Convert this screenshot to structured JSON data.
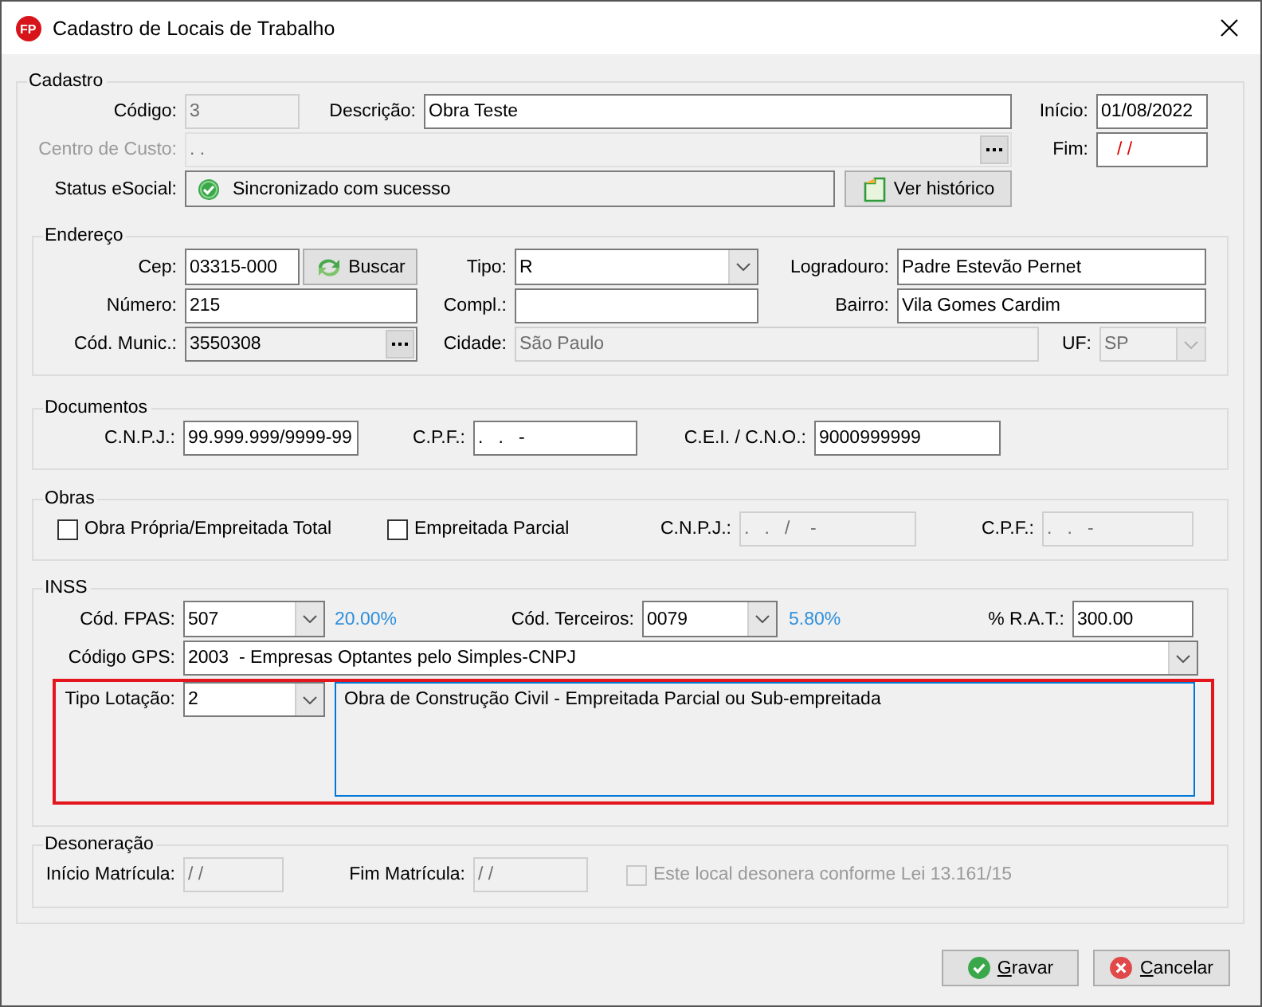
{
  "window": {
    "title": "Cadastro de Locais de Trabalho",
    "logo_text": "FP"
  },
  "cadastro": {
    "legend": "Cadastro",
    "codigo": {
      "label": "Código:",
      "value": "3",
      "read_only": true
    },
    "descricao": {
      "label": "Descrição:",
      "value": "Obra Teste"
    },
    "inicio": {
      "label": "Início:",
      "value": "01/08/2022"
    },
    "centro_de_custo": {
      "label": "Centro de Custo:",
      "value": ". .",
      "disabled": true
    },
    "fim": {
      "label": "Fim:",
      "value": "/ /",
      "error": true
    },
    "status_esocial": {
      "label": "Status eSocial:",
      "value": "Sincronizado com sucesso"
    },
    "history_button": "Ver histórico"
  },
  "endereco": {
    "legend": "Endereço",
    "cep": {
      "label": "Cep:",
      "value": "03315-000"
    },
    "search_button": "Buscar",
    "tipo": {
      "label": "Tipo:",
      "value": "R"
    },
    "logradouro": {
      "label": "Logradouro:",
      "value": "Padre Estevão Pernet"
    },
    "numero": {
      "label": "Número:",
      "value": "215"
    },
    "compl": {
      "label": "Compl.:"
    },
    "bairro": {
      "label": "Bairro:",
      "value": "Vila Gomes Cardim"
    },
    "cod_munic": {
      "label": "Cód. Munic.:",
      "value": "3550308",
      "read_only": true
    },
    "cidade": {
      "label": "Cidade:",
      "value": "São Paulo",
      "read_only": true
    },
    "uf": {
      "label": "UF:",
      "value": "SP",
      "read_only": true
    }
  },
  "documentos": {
    "legend": "Documentos",
    "cnpj": {
      "label": "C.N.P.J.:",
      "value": "99.999.999/9999-99"
    },
    "cpf": {
      "label": "C.P.F.:",
      "value": ".   .   -"
    },
    "cei_cno": {
      "label": "C.E.I. / C.N.O.:",
      "value": "9000999999"
    }
  },
  "obras": {
    "legend": "Obras",
    "obra_propria": {
      "label": "Obra Própria/Empreitada Total",
      "checked": false
    },
    "empreitada_parcial": {
      "label": "Empreitada Parcial",
      "checked": false
    },
    "cnpj": {
      "label": "C.N.P.J.:",
      "value": ".   .   /    -",
      "read_only": true
    },
    "cpf": {
      "label": "C.P.F.:",
      "value": ".   .   -",
      "read_only": true
    }
  },
  "inss": {
    "legend": "INSS",
    "fpas": {
      "label": "Cód. FPAS:",
      "value": "507"
    },
    "fpas_rate": "20.00%",
    "terceiros": {
      "label": "Cód. Terceiros:",
      "value": "0079"
    },
    "terceiros_rate": "5.80%",
    "rat": {
      "label": "% R.A.T.:",
      "value": "300.00"
    },
    "gps": {
      "label": "Código GPS:",
      "value": "2003  - Empresas Optantes pelo Simples-CNPJ"
    },
    "tipo_lotacao": {
      "label": "Tipo Lotação:",
      "value": "2"
    },
    "tipo_lotacao_description": "Obra de Construção Civil - Empreitada Parcial ou Sub-empreitada"
  },
  "desoneracao": {
    "legend": "Desoneração",
    "inicio_matricula": {
      "label": "Início Matrícula:",
      "value": "/ /",
      "read_only": true
    },
    "fim_matricula": {
      "label": "Fim Matrícula:",
      "value": "/ /",
      "read_only": true
    },
    "desonera": {
      "label": "Este local desonera conforme Lei 13.161/15",
      "checked": false,
      "disabled": true
    }
  },
  "buttons": [
    {
      "kind": "save",
      "label": "Gravar"
    },
    {
      "kind": "cancel",
      "label": "Cancelar"
    }
  ]
}
